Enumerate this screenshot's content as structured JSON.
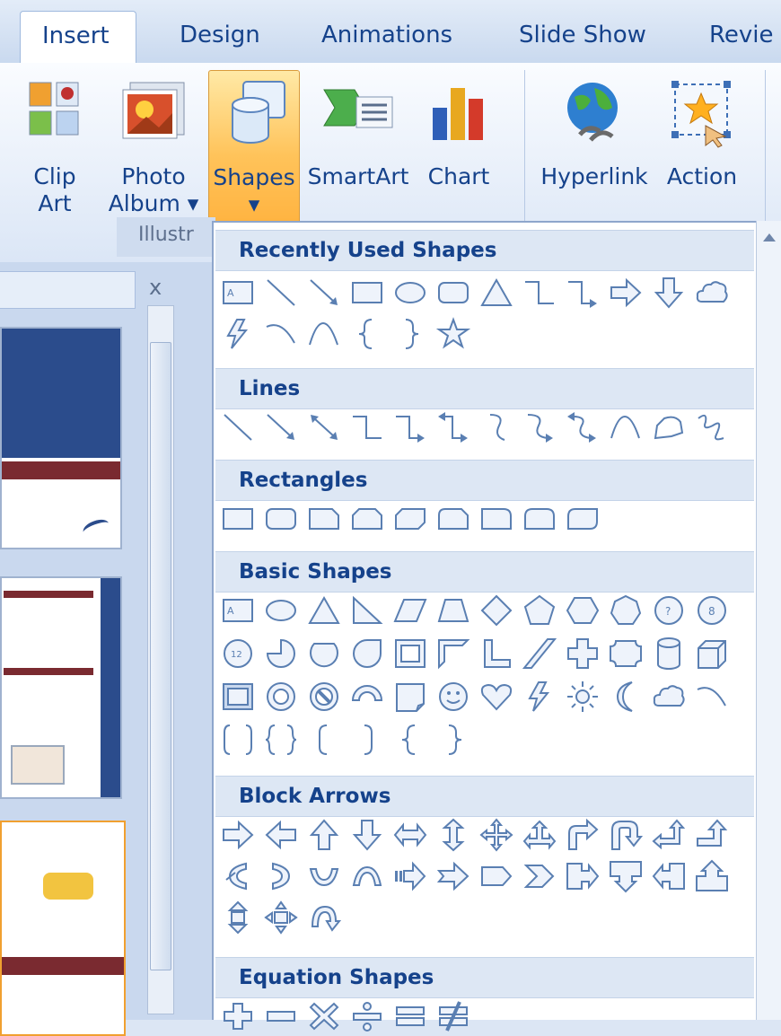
{
  "tabs": [
    {
      "label": "Insert",
      "active": true
    },
    {
      "label": "Design"
    },
    {
      "label": "Animations"
    },
    {
      "label": "Slide Show"
    },
    {
      "label": "Revie"
    }
  ],
  "ribbon": {
    "buttons": [
      {
        "label": "Clip\nArt",
        "icon": "clip-art-icon"
      },
      {
        "label": "Photo\nAlbum ▾",
        "icon": "photo-album-icon"
      },
      {
        "label": "Shapes\n▾",
        "icon": "shapes-icon",
        "selected": true
      },
      {
        "label": "SmartArt",
        "icon": "smartart-icon"
      },
      {
        "label": "Chart",
        "icon": "chart-icon"
      },
      {
        "label": "Hyperlink",
        "icon": "hyperlink-icon"
      },
      {
        "label": "Action",
        "icon": "action-icon"
      }
    ],
    "group_label": "Illustr"
  },
  "pane": {
    "close_glyph": "x"
  },
  "gallery": {
    "sections": [
      {
        "title": "Recently Used Shapes",
        "rows": [
          [
            "textbox",
            "line",
            "arrow",
            "rect",
            "oval",
            "roundrect",
            "triangle",
            "elbow",
            "elbowArrow",
            "rightArrow",
            "downArrow",
            "cloud"
          ],
          [
            "lightning",
            "arc",
            "curve",
            "lbrace",
            "rbrace",
            "star"
          ]
        ]
      },
      {
        "title": "Lines",
        "rows": [
          [
            "line",
            "arrow",
            "dblArrow",
            "elbow",
            "elbowArrow",
            "elbowDbl",
            "curvedConn",
            "curvedArrow",
            "curvedDbl",
            "curve",
            "freeform",
            "scribble"
          ]
        ]
      },
      {
        "title": "Rectangles",
        "rows": [
          [
            "rect",
            "roundrect",
            "snip1",
            "snip2",
            "snipDiag",
            "snipRound",
            "round1",
            "round2",
            "roundDiag"
          ]
        ]
      },
      {
        "title": "Basic Shapes",
        "rows": [
          [
            "textbox",
            "oval",
            "triangle",
            "rtTriangle",
            "parallelogram",
            "trapezoid",
            "diamond",
            "pentagon",
            "hexagon",
            "heptagon",
            "octagon",
            "decagon"
          ],
          [
            "dodecagon",
            "pie",
            "chord",
            "teardrop",
            "frame",
            "halfFrame",
            "lShape",
            "diagStripe",
            "plus",
            "plaque",
            "can",
            "cube"
          ],
          [
            "bevel",
            "donut",
            "noSmoking",
            "blockArc",
            "foldedCorner",
            "smiley",
            "heart",
            "lightning",
            "sun",
            "moon",
            "cloud",
            "arc"
          ],
          [
            "dblBracket",
            "dblBrace",
            "lbracket",
            "rbracket",
            "lbrace",
            "rbrace"
          ]
        ]
      },
      {
        "title": "Block Arrows",
        "rows": [
          [
            "rightArrow",
            "leftArrow",
            "upArrow",
            "downArrow",
            "lrArrow",
            "udArrow",
            "quadArrow",
            "lruArrow",
            "bentArrow",
            "uturnArrow",
            "luArrow",
            "bentUp"
          ],
          [
            "curvedLeft",
            "curvedRight",
            "curvedUp",
            "curvedDown",
            "stripedRight",
            "notchedRight",
            "pentagonArrow",
            "chevron",
            "rightCallout",
            "downCallout",
            "leftCallout",
            "upCallout"
          ],
          [
            "udCallout",
            "quadCallout",
            "circularArrow"
          ]
        ]
      },
      {
        "title": "Equation Shapes",
        "rows": [
          [
            "mathPlus",
            "mathMinus",
            "mathMultiply",
            "mathDivide",
            "mathEqual",
            "mathNotEqual"
          ]
        ]
      }
    ]
  },
  "colors": {
    "accent": "#15428b",
    "shape_stroke": "#5a7fb2",
    "shape_fill": "#eef3fb",
    "selected": "#ffc35a"
  }
}
